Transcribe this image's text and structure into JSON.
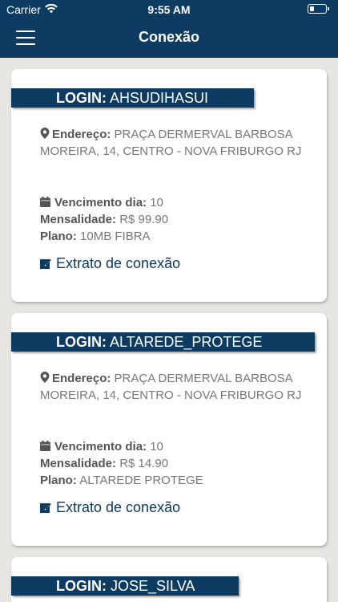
{
  "status_bar": {
    "carrier": "Carrier",
    "time": "9:55 AM"
  },
  "header": {
    "title": "Conexão"
  },
  "labels": {
    "login": "LOGIN:",
    "endereco": "Endereço:",
    "vencimento": "Vencimento dia:",
    "mensalidade": "Mensalidade:",
    "plano": "Plano:",
    "extrato": "Extrato de conexão"
  },
  "connections": [
    {
      "login": "AHSUDIHASUI",
      "endereco": "PRAÇA DERMERVAL BARBOSA MOREIRA, 14, CENTRO - NOVA FRIBURGO RJ",
      "vencimento": "10",
      "mensalidade": "R$ 99.90",
      "plano": "10MB FIBRA"
    },
    {
      "login": "ALTAREDE_PROTEGE",
      "endereco": "PRAÇA DERMERVAL BARBOSA MOREIRA, 14, CENTRO - NOVA FRIBURGO RJ",
      "vencimento": "10",
      "mensalidade": "R$ 14.90",
      "plano": "ALTAREDE PROTEGE"
    },
    {
      "login": "JOSE_SILVA"
    }
  ],
  "colors": {
    "header": "#0d3b61",
    "background": "#e7e6e3",
    "card": "#ffffff",
    "text_muted": "#777777"
  }
}
